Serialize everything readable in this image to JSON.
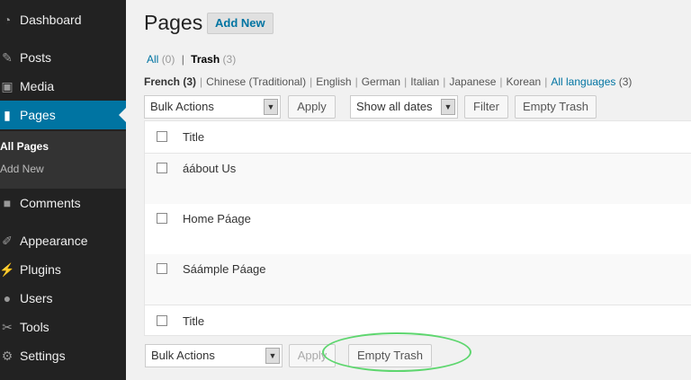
{
  "sidebar": {
    "items": [
      {
        "label": "Dashboard",
        "icon": "dashboard-icon"
      },
      {
        "label": "Posts",
        "icon": "pin-icon"
      },
      {
        "label": "Media",
        "icon": "media-icon"
      },
      {
        "label": "Pages",
        "icon": "pages-icon"
      },
      {
        "label": "Comments",
        "icon": "comment-icon"
      },
      {
        "label": "Appearance",
        "icon": "brush-icon"
      },
      {
        "label": "Plugins",
        "icon": "plugin-icon"
      },
      {
        "label": "Users",
        "icon": "users-icon"
      },
      {
        "label": "Tools",
        "icon": "wrench-icon"
      },
      {
        "label": "Settings",
        "icon": "settings-icon"
      }
    ],
    "submenu": [
      {
        "label": "All Pages"
      },
      {
        "label": "Add New"
      }
    ]
  },
  "header": {
    "title": "Pages",
    "add_new": "Add New"
  },
  "views": {
    "all_label": "All",
    "all_count": "(0)",
    "trash_label": "Trash",
    "trash_count": "(3)",
    "separator": "|"
  },
  "languages": {
    "french": "French",
    "french_count": "(3)",
    "others": [
      "Chinese (Traditional)",
      "English",
      "German",
      "Italian",
      "Japanese",
      "Korean"
    ],
    "all_languages": "All languages",
    "all_languages_count": "(3)",
    "separator": "|"
  },
  "toolbar_top": {
    "bulk_actions": "Bulk Actions",
    "apply": "Apply",
    "dates": "Show all dates",
    "filter": "Filter",
    "empty_trash": "Empty Trash"
  },
  "table": {
    "column_title": "Title",
    "rows": [
      {
        "title": "áábout Us"
      },
      {
        "title": "Home Páage"
      },
      {
        "title": "Sáámple Páage"
      }
    ],
    "footer_title": "Title"
  },
  "toolbar_bottom": {
    "bulk_actions": "Bulk Actions",
    "apply": "Apply",
    "empty_trash": "Empty Trash"
  },
  "colors": {
    "sidebar_bg": "#222222",
    "active_bg": "#0074a2",
    "link": "#0074a2",
    "highlight": "#5dd66e"
  }
}
